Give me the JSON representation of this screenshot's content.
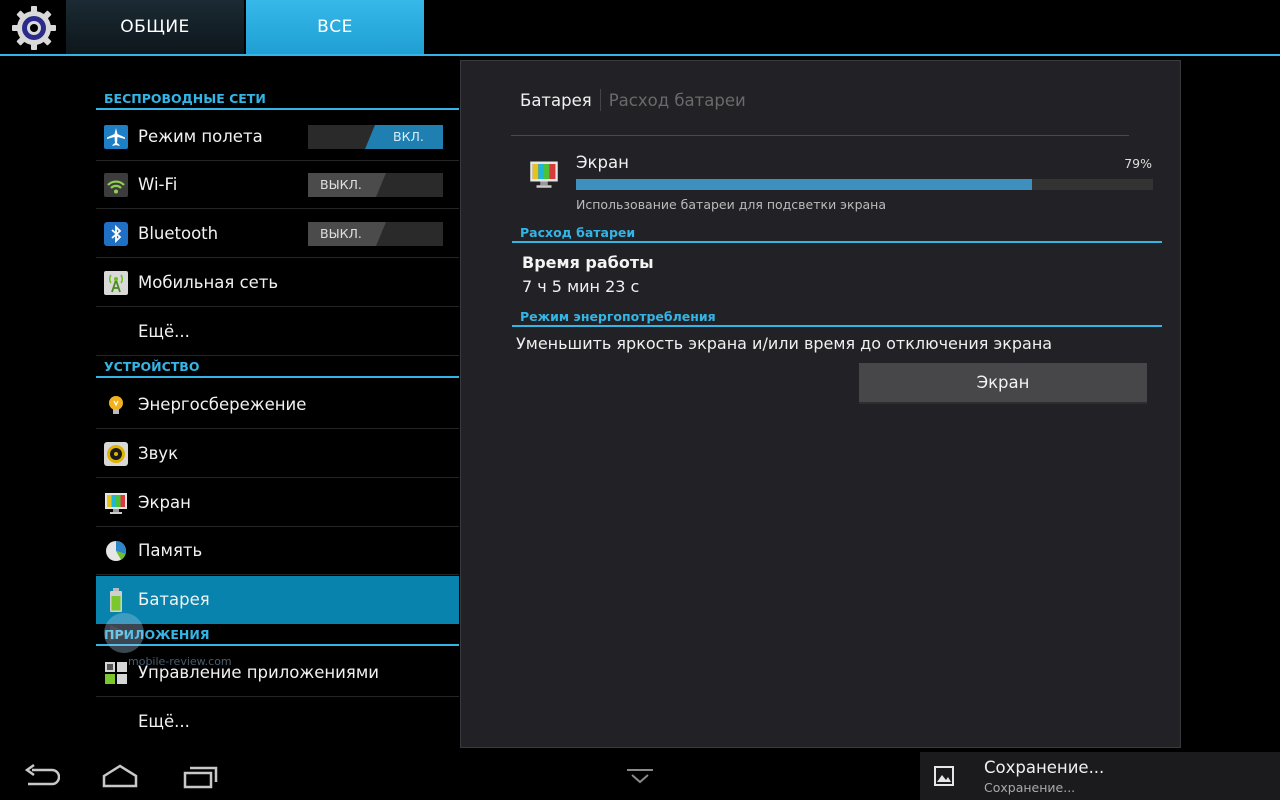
{
  "tabs": {
    "general": "ОБЩИЕ",
    "all": "ВСЕ"
  },
  "sections": {
    "wireless": "БЕСПРОВОДНЫЕ СЕТИ",
    "device": "УСТРОЙСТВО",
    "apps": "ПРИЛОЖЕНИЯ"
  },
  "items": {
    "airplane": {
      "label": "Режим полета",
      "toggle": "ВКЛ."
    },
    "wifi": {
      "label": "Wi-Fi",
      "toggle": "ВЫКЛ."
    },
    "bluetooth": {
      "label": "Bluetooth",
      "toggle": "ВЫКЛ."
    },
    "mobile": {
      "label": "Мобильная сеть"
    },
    "more_wireless": {
      "label": "Ещё..."
    },
    "power": {
      "label": "Энергосбережение"
    },
    "sound": {
      "label": "Звук"
    },
    "display": {
      "label": "Экран"
    },
    "storage": {
      "label": "Память"
    },
    "battery": {
      "label": "Батарея"
    },
    "app_manager": {
      "label": "Управление приложениями"
    },
    "more_apps": {
      "label": "Ещё..."
    }
  },
  "panel": {
    "breadcrumb_current": "Батарея",
    "breadcrumb_other": "Расход батареи",
    "usage": {
      "title": "Экран",
      "percent_text": "79%",
      "percent_value": 79,
      "description": "Использование батареи для подсветки экрана"
    },
    "battery_use_header": "Расход батареи",
    "uptime_label": "Время работы",
    "uptime_value": "7 ч 5 мин 23 с",
    "power_mode_header": "Режим энергопотребления",
    "power_mode_desc": "Уменьшить яркость экрана и/или время до отключения экрана",
    "screen_button": "Экран"
  },
  "watermark": "mobile-review.com",
  "notification": {
    "title": "Сохранение...",
    "subtitle": "Сохранение..."
  },
  "colors": {
    "accent": "#33b5e5",
    "selected": "#0883ad",
    "panel_bg": "#222226"
  }
}
